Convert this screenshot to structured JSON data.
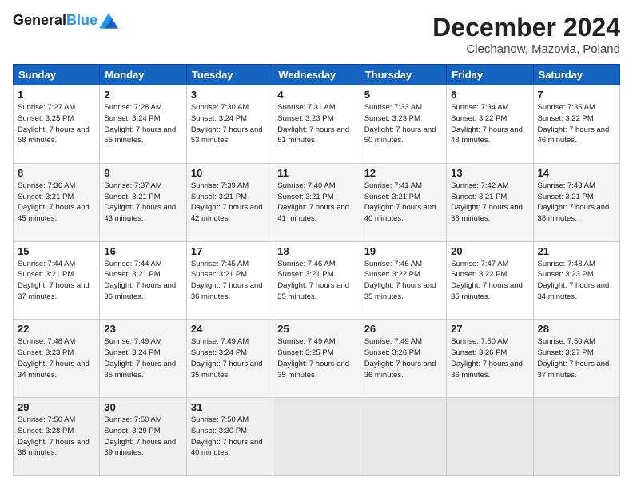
{
  "header": {
    "logo_line1": "General",
    "logo_line2": "Blue",
    "month": "December 2024",
    "location": "Ciechanow, Mazovia, Poland"
  },
  "weekdays": [
    "Sunday",
    "Monday",
    "Tuesday",
    "Wednesday",
    "Thursday",
    "Friday",
    "Saturday"
  ],
  "weeks": [
    [
      {
        "day": "1",
        "sunrise": "Sunrise: 7:27 AM",
        "sunset": "Sunset: 3:25 PM",
        "daylight": "Daylight: 7 hours and 58 minutes."
      },
      {
        "day": "2",
        "sunrise": "Sunrise: 7:28 AM",
        "sunset": "Sunset: 3:24 PM",
        "daylight": "Daylight: 7 hours and 55 minutes."
      },
      {
        "day": "3",
        "sunrise": "Sunrise: 7:30 AM",
        "sunset": "Sunset: 3:24 PM",
        "daylight": "Daylight: 7 hours and 53 minutes."
      },
      {
        "day": "4",
        "sunrise": "Sunrise: 7:31 AM",
        "sunset": "Sunset: 3:23 PM",
        "daylight": "Daylight: 7 hours and 51 minutes."
      },
      {
        "day": "5",
        "sunrise": "Sunrise: 7:33 AM",
        "sunset": "Sunset: 3:23 PM",
        "daylight": "Daylight: 7 hours and 50 minutes."
      },
      {
        "day": "6",
        "sunrise": "Sunrise: 7:34 AM",
        "sunset": "Sunset: 3:22 PM",
        "daylight": "Daylight: 7 hours and 48 minutes."
      },
      {
        "day": "7",
        "sunrise": "Sunrise: 7:35 AM",
        "sunset": "Sunset: 3:22 PM",
        "daylight": "Daylight: 7 hours and 46 minutes."
      }
    ],
    [
      {
        "day": "8",
        "sunrise": "Sunrise: 7:36 AM",
        "sunset": "Sunset: 3:21 PM",
        "daylight": "Daylight: 7 hours and 45 minutes."
      },
      {
        "day": "9",
        "sunrise": "Sunrise: 7:37 AM",
        "sunset": "Sunset: 3:21 PM",
        "daylight": "Daylight: 7 hours and 43 minutes."
      },
      {
        "day": "10",
        "sunrise": "Sunrise: 7:39 AM",
        "sunset": "Sunset: 3:21 PM",
        "daylight": "Daylight: 7 hours and 42 minutes."
      },
      {
        "day": "11",
        "sunrise": "Sunrise: 7:40 AM",
        "sunset": "Sunset: 3:21 PM",
        "daylight": "Daylight: 7 hours and 41 minutes."
      },
      {
        "day": "12",
        "sunrise": "Sunrise: 7:41 AM",
        "sunset": "Sunset: 3:21 PM",
        "daylight": "Daylight: 7 hours and 40 minutes."
      },
      {
        "day": "13",
        "sunrise": "Sunrise: 7:42 AM",
        "sunset": "Sunset: 3:21 PM",
        "daylight": "Daylight: 7 hours and 38 minutes."
      },
      {
        "day": "14",
        "sunrise": "Sunrise: 7:43 AM",
        "sunset": "Sunset: 3:21 PM",
        "daylight": "Daylight: 7 hours and 38 minutes."
      }
    ],
    [
      {
        "day": "15",
        "sunrise": "Sunrise: 7:44 AM",
        "sunset": "Sunset: 3:21 PM",
        "daylight": "Daylight: 7 hours and 37 minutes."
      },
      {
        "day": "16",
        "sunrise": "Sunrise: 7:44 AM",
        "sunset": "Sunset: 3:21 PM",
        "daylight": "Daylight: 7 hours and 36 minutes."
      },
      {
        "day": "17",
        "sunrise": "Sunrise: 7:45 AM",
        "sunset": "Sunset: 3:21 PM",
        "daylight": "Daylight: 7 hours and 36 minutes."
      },
      {
        "day": "18",
        "sunrise": "Sunrise: 7:46 AM",
        "sunset": "Sunset: 3:21 PM",
        "daylight": "Daylight: 7 hours and 35 minutes."
      },
      {
        "day": "19",
        "sunrise": "Sunrise: 7:46 AM",
        "sunset": "Sunset: 3:22 PM",
        "daylight": "Daylight: 7 hours and 35 minutes."
      },
      {
        "day": "20",
        "sunrise": "Sunrise: 7:47 AM",
        "sunset": "Sunset: 3:22 PM",
        "daylight": "Daylight: 7 hours and 35 minutes."
      },
      {
        "day": "21",
        "sunrise": "Sunrise: 7:48 AM",
        "sunset": "Sunset: 3:23 PM",
        "daylight": "Daylight: 7 hours and 34 minutes."
      }
    ],
    [
      {
        "day": "22",
        "sunrise": "Sunrise: 7:48 AM",
        "sunset": "Sunset: 3:23 PM",
        "daylight": "Daylight: 7 hours and 34 minutes."
      },
      {
        "day": "23",
        "sunrise": "Sunrise: 7:49 AM",
        "sunset": "Sunset: 3:24 PM",
        "daylight": "Daylight: 7 hours and 35 minutes."
      },
      {
        "day": "24",
        "sunrise": "Sunrise: 7:49 AM",
        "sunset": "Sunset: 3:24 PM",
        "daylight": "Daylight: 7 hours and 35 minutes."
      },
      {
        "day": "25",
        "sunrise": "Sunrise: 7:49 AM",
        "sunset": "Sunset: 3:25 PM",
        "daylight": "Daylight: 7 hours and 35 minutes."
      },
      {
        "day": "26",
        "sunrise": "Sunrise: 7:49 AM",
        "sunset": "Sunset: 3:26 PM",
        "daylight": "Daylight: 7 hours and 36 minutes."
      },
      {
        "day": "27",
        "sunrise": "Sunrise: 7:50 AM",
        "sunset": "Sunset: 3:26 PM",
        "daylight": "Daylight: 7 hours and 36 minutes."
      },
      {
        "day": "28",
        "sunrise": "Sunrise: 7:50 AM",
        "sunset": "Sunset: 3:27 PM",
        "daylight": "Daylight: 7 hours and 37 minutes."
      }
    ],
    [
      {
        "day": "29",
        "sunrise": "Sunrise: 7:50 AM",
        "sunset": "Sunset: 3:28 PM",
        "daylight": "Daylight: 7 hours and 38 minutes."
      },
      {
        "day": "30",
        "sunrise": "Sunrise: 7:50 AM",
        "sunset": "Sunset: 3:29 PM",
        "daylight": "Daylight: 7 hours and 39 minutes."
      },
      {
        "day": "31",
        "sunrise": "Sunrise: 7:50 AM",
        "sunset": "Sunset: 3:30 PM",
        "daylight": "Daylight: 7 hours and 40 minutes."
      },
      null,
      null,
      null,
      null
    ]
  ]
}
